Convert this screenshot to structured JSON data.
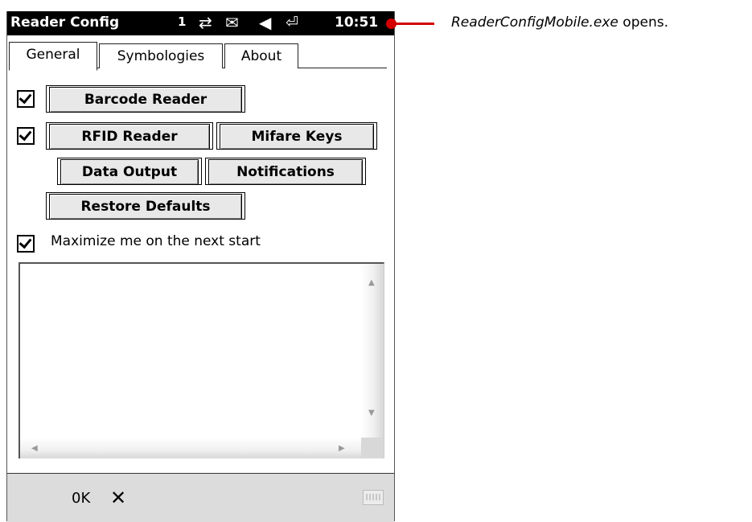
{
  "titlebar": {
    "title": "Reader Config",
    "signal": "1",
    "icons": [
      "sync-icon",
      "message-icon",
      "speaker-icon",
      "battery-icon"
    ],
    "clock": "10:51"
  },
  "callout": {
    "filename": "ReaderConfigMobile.exe",
    "suffix": " opens."
  },
  "tabs": [
    "General",
    "Symbologies",
    "About"
  ],
  "buttons": {
    "barcode": "Barcode Reader",
    "rfid": "RFID Reader",
    "mifare": "Mifare Keys",
    "data_output": "Data Output",
    "notifications": "Notifications",
    "restore": "Restore Defaults"
  },
  "checkboxes": {
    "barcode_checked": true,
    "rfid_checked": true,
    "maximize_checked": true
  },
  "maximize_label": "Maximize me on the next start",
  "bottombar": {
    "ok": "0K",
    "close": "✕"
  },
  "colors": {
    "accent": "#d40000",
    "titlebar": "#000000",
    "button_face": "#e8e8e8",
    "menubar": "#dcdcdc"
  }
}
